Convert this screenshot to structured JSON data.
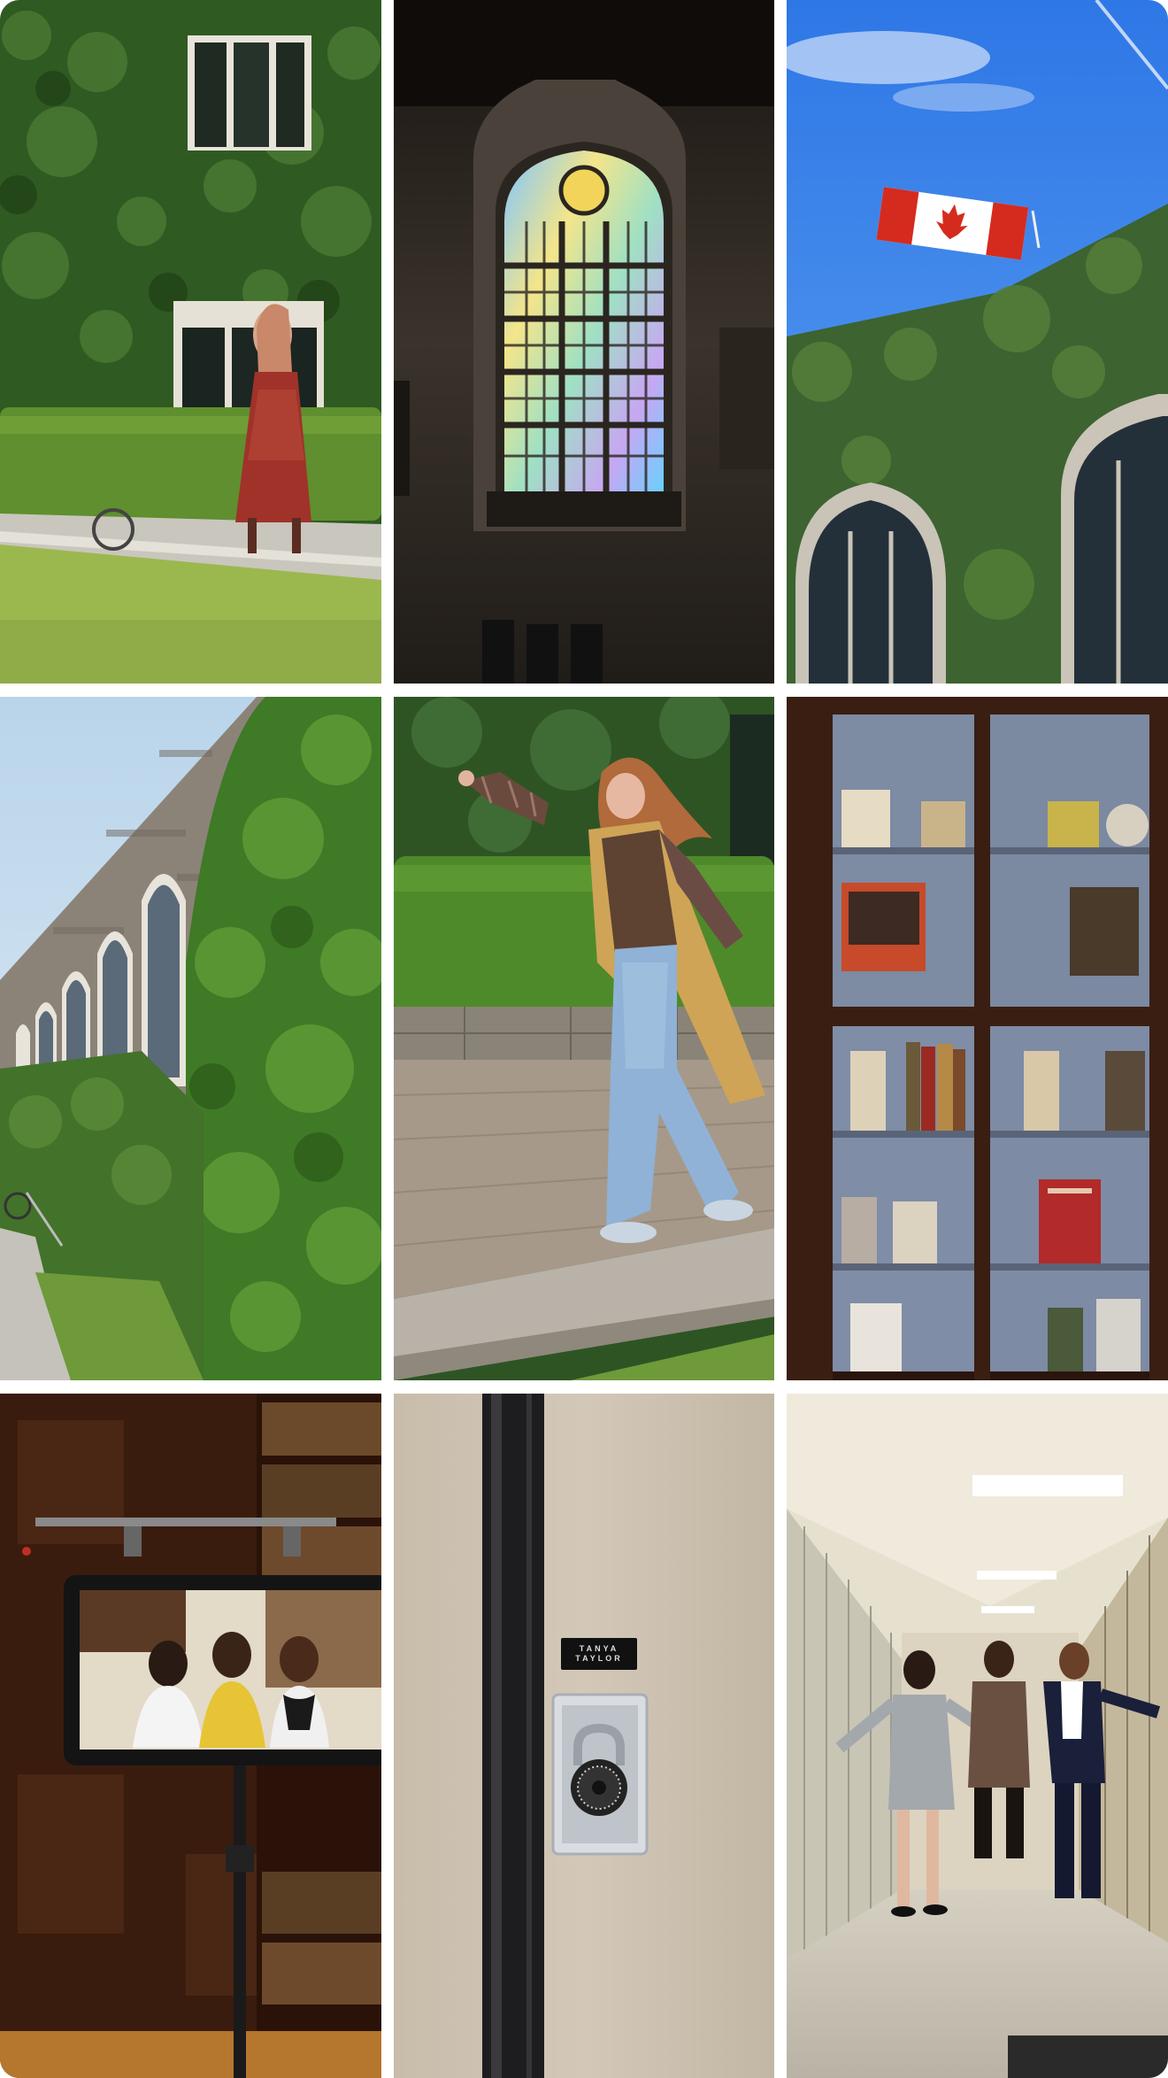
{
  "gallery": {
    "tiles": [
      {
        "name": "photo-ivy-building-walking-woman",
        "row": 0,
        "col": 0
      },
      {
        "name": "photo-stained-glass-window",
        "row": 0,
        "col": 1
      },
      {
        "name": "photo-canadian-flag-ivy-roof",
        "row": 0,
        "col": 2
      },
      {
        "name": "photo-ivy-stone-gothic-building",
        "row": 1,
        "col": 0
      },
      {
        "name": "photo-woman-plaid-shirt-dancing",
        "row": 1,
        "col": 1
      },
      {
        "name": "photo-display-cabinet-books",
        "row": 1,
        "col": 2
      },
      {
        "name": "photo-tablet-monitor-library",
        "row": 2,
        "col": 0
      },
      {
        "name": "photo-locker-combination-lock",
        "row": 2,
        "col": 1
      },
      {
        "name": "photo-hallway-three-women",
        "row": 2,
        "col": 2
      }
    ]
  },
  "locker_plate": {
    "line1": "TANYA",
    "line2": "TAYLOR"
  },
  "colors": {
    "ivy": "#3e6b2a",
    "sky": "#3b7de0",
    "flag_red": "#d52b1e",
    "cabinet_wood": "#3a1e12",
    "locker_beige": "#cfc3b2"
  }
}
